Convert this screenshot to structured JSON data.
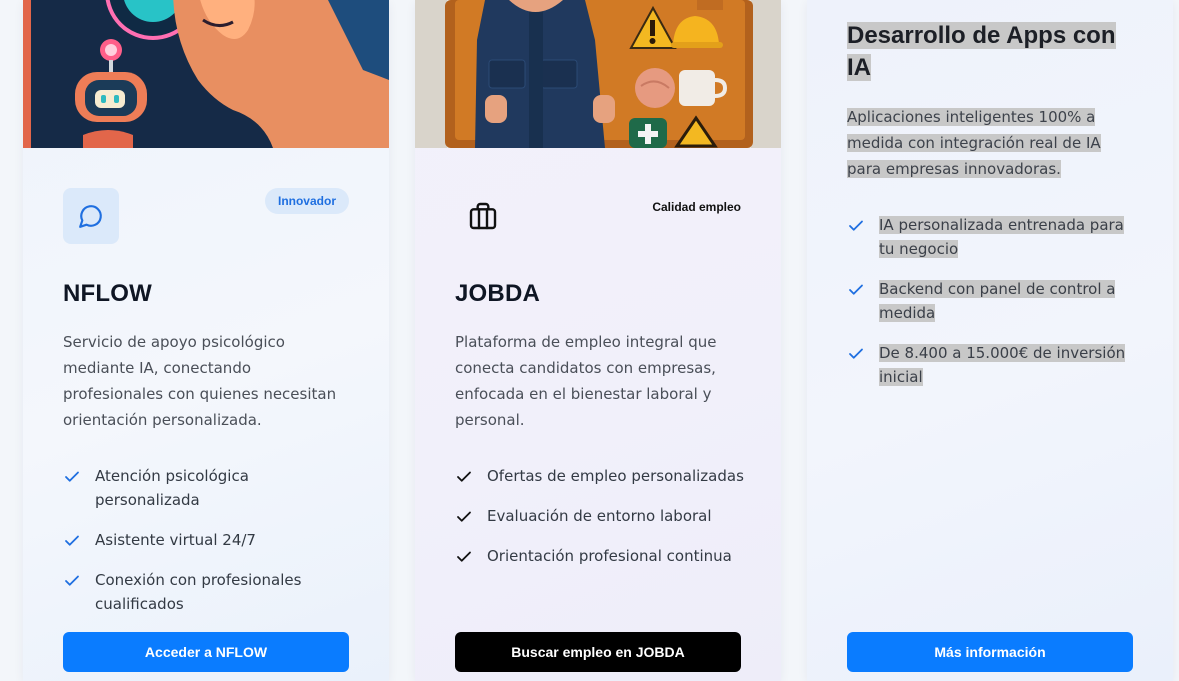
{
  "cards": [
    {
      "badge": "Innovador",
      "title": "NFLOW",
      "description": "Servicio de apoyo psicológico mediante IA, conectando profesionales con quienes necesitan orientación personalizada.",
      "features": [
        "Atención psicológica personalizada",
        "Asistente virtual 24/7",
        "Conexión con profesionales cualificados"
      ],
      "button": "Acceder a NFLOW",
      "icon": "chat-bubble-icon",
      "accent": "#0a7cff"
    },
    {
      "badge": "Calidad empleo",
      "title": "JOBDA",
      "description": "Plataforma de empleo integral que conecta candidatos con empresas, enfocada en el bienestar laboral y personal.",
      "features": [
        "Ofertas de empleo personalizadas",
        "Evaluación de entorno laboral",
        "Orientación profesional continua"
      ],
      "button": "Buscar empleo en JOBDA",
      "icon": "briefcase-icon",
      "accent": "#000000"
    },
    {
      "title": "Desarrollo de Apps con IA",
      "description": "Aplicaciones inteligentes 100% a medida con integración real de IA para empresas innovadoras.",
      "features": [
        "IA personalizada entrenada para tu negocio",
        "Backend con panel de control a medida",
        "De 8.400 a 15.000€ de inversión inicial"
      ],
      "button": "Más información",
      "accent": "#0a7cff"
    }
  ]
}
